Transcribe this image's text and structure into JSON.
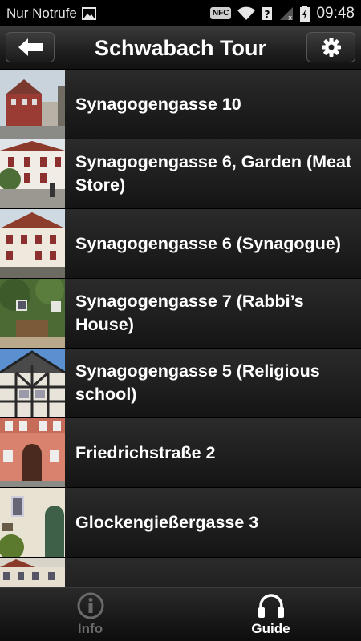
{
  "status_bar": {
    "carrier": "Nur Notrufe",
    "time": "09:48",
    "nfc_label": "NFC",
    "icons": [
      "image-icon",
      "nfc-icon",
      "wifi-icon",
      "sim-unknown-icon",
      "signal-icon",
      "battery-charging-icon"
    ]
  },
  "header": {
    "title": "Schwabach Tour",
    "back_icon": "arrow-left-icon",
    "settings_icon": "gear-icon"
  },
  "list": {
    "items": [
      {
        "label": "Synagogengasse 10"
      },
      {
        "label": "Synagogengasse 6, Garden (Meat Store)"
      },
      {
        "label": "Synagogengasse 6 (Synagogue)"
      },
      {
        "label": "Synagogengasse 7 (Rabbi’s House)"
      },
      {
        "label": "Synagogengasse 5 (Religious school)"
      },
      {
        "label": "Friedrichstraße 2"
      },
      {
        "label": "Glockengießergasse 3"
      },
      {
        "label": ""
      }
    ]
  },
  "tabbar": {
    "tabs": [
      {
        "label": "Info",
        "icon": "info-icon",
        "active": false
      },
      {
        "label": "Guide",
        "icon": "headphones-icon",
        "active": true
      }
    ]
  }
}
